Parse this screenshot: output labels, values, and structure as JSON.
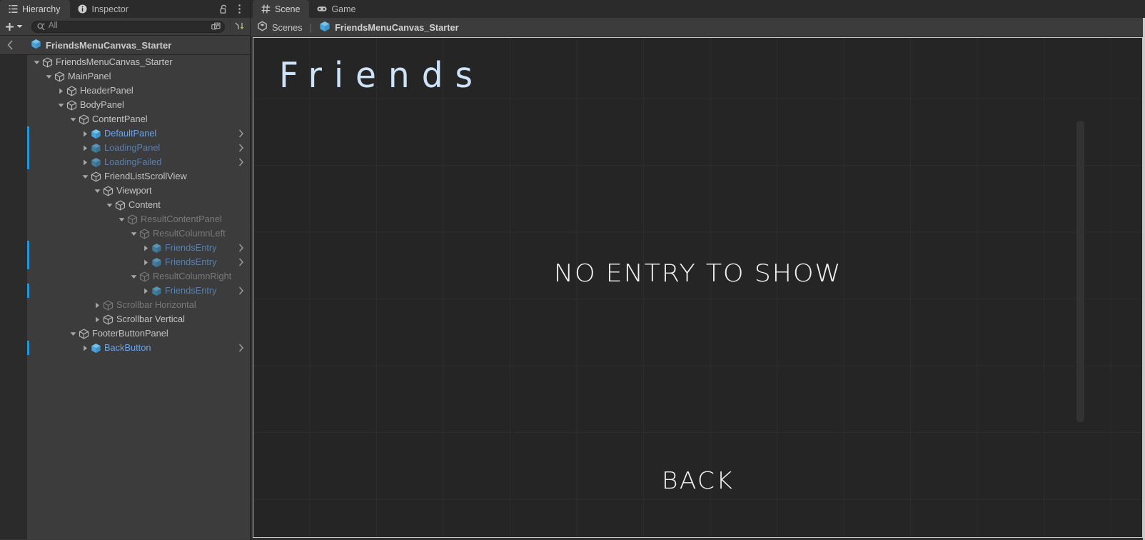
{
  "hierarchy_panel": {
    "tabs": [
      {
        "label": "Hierarchy",
        "icon": "hierarchy-icon",
        "active": true
      },
      {
        "label": "Inspector",
        "icon": "info-icon",
        "active": false
      }
    ],
    "tab_tools": [
      {
        "name": "lock-icon",
        "tooltip": "Lock"
      },
      {
        "name": "kebab-menu-icon",
        "tooltip": "More"
      }
    ],
    "toolbar": {
      "create_label": "+",
      "create_dropdown_icon": "chevron-down-icon",
      "search": {
        "value": "All",
        "placeholder": "All",
        "icon": "search-icon"
      },
      "search_in_scene_icon": "search-in-scene-icon",
      "sort_icon": "sort-icon"
    },
    "prefab_header": {
      "back_icon": "chevron-left-icon",
      "title": "FriendsMenuCanvas_Starter",
      "icon": "prefab-cube-icon"
    },
    "tree": [
      {
        "label": "FriendsMenuCanvas_Starter",
        "depth": 1,
        "twisty": "down",
        "icon": "gameobject-icon",
        "dim": false,
        "prefab": false,
        "prefab_bar": false,
        "chevron": false
      },
      {
        "label": "MainPanel",
        "depth": 2,
        "twisty": "down",
        "icon": "gameobject-icon",
        "dim": false,
        "prefab": false,
        "prefab_bar": false,
        "chevron": false
      },
      {
        "label": "HeaderPanel",
        "depth": 3,
        "twisty": "right",
        "icon": "gameobject-icon",
        "dim": false,
        "prefab": false,
        "prefab_bar": false,
        "chevron": false
      },
      {
        "label": "BodyPanel",
        "depth": 3,
        "twisty": "down",
        "icon": "gameobject-icon",
        "dim": false,
        "prefab": false,
        "prefab_bar": false,
        "chevron": false
      },
      {
        "label": "ContentPanel",
        "depth": 4,
        "twisty": "down",
        "icon": "gameobject-icon",
        "dim": false,
        "prefab": false,
        "prefab_bar": false,
        "chevron": false
      },
      {
        "label": "DefaultPanel",
        "depth": 5,
        "twisty": "right",
        "icon": "prefab-cube-icon",
        "dim": false,
        "prefab": true,
        "prefab_bar": true,
        "chevron": true
      },
      {
        "label": "LoadingPanel",
        "depth": 5,
        "twisty": "right",
        "icon": "prefab-cube-icon",
        "dim": true,
        "prefab": true,
        "prefab_bar": true,
        "chevron": true
      },
      {
        "label": "LoadingFailed",
        "depth": 5,
        "twisty": "right",
        "icon": "prefab-cube-icon",
        "dim": true,
        "prefab": true,
        "prefab_bar": true,
        "chevron": true
      },
      {
        "label": "FriendListScrollView",
        "depth": 5,
        "twisty": "down",
        "icon": "gameobject-icon",
        "dim": false,
        "prefab": false,
        "prefab_bar": false,
        "chevron": false
      },
      {
        "label": "Viewport",
        "depth": 6,
        "twisty": "down",
        "icon": "gameobject-icon",
        "dim": false,
        "prefab": false,
        "prefab_bar": false,
        "chevron": false
      },
      {
        "label": "Content",
        "depth": 7,
        "twisty": "down",
        "icon": "gameobject-icon",
        "dim": false,
        "prefab": false,
        "prefab_bar": false,
        "chevron": false
      },
      {
        "label": "ResultContentPanel",
        "depth": 8,
        "twisty": "down",
        "icon": "gameobject-icon",
        "dim": true,
        "prefab": false,
        "prefab_bar": false,
        "chevron": false
      },
      {
        "label": "ResultColumnLeft",
        "depth": 9,
        "twisty": "down",
        "icon": "gameobject-icon",
        "dim": true,
        "prefab": false,
        "prefab_bar": false,
        "chevron": false
      },
      {
        "label": "FriendsEntry",
        "depth": 10,
        "twisty": "right",
        "icon": "prefab-cube-icon",
        "dim": true,
        "prefab": true,
        "prefab_bar": true,
        "chevron": true
      },
      {
        "label": "FriendsEntry",
        "depth": 10,
        "twisty": "right",
        "icon": "prefab-cube-icon",
        "dim": true,
        "prefab": true,
        "prefab_bar": true,
        "chevron": true
      },
      {
        "label": "ResultColumnRight",
        "depth": 9,
        "twisty": "down",
        "icon": "gameobject-icon",
        "dim": true,
        "prefab": false,
        "prefab_bar": false,
        "chevron": false
      },
      {
        "label": "FriendsEntry",
        "depth": 10,
        "twisty": "right",
        "icon": "prefab-cube-icon",
        "dim": true,
        "prefab": true,
        "prefab_bar": true,
        "chevron": true
      },
      {
        "label": "Scrollbar Horizontal",
        "depth": 6,
        "twisty": "right",
        "icon": "gameobject-icon",
        "dim": true,
        "prefab": false,
        "prefab_bar": false,
        "chevron": false
      },
      {
        "label": "Scrollbar Vertical",
        "depth": 6,
        "twisty": "right",
        "icon": "gameobject-icon",
        "dim": false,
        "prefab": false,
        "prefab_bar": false,
        "chevron": false
      },
      {
        "label": "FooterButtonPanel",
        "depth": 4,
        "twisty": "down",
        "icon": "gameobject-icon",
        "dim": false,
        "prefab": false,
        "prefab_bar": false,
        "chevron": false
      },
      {
        "label": "BackButton",
        "depth": 5,
        "twisty": "right",
        "icon": "prefab-cube-icon",
        "dim": false,
        "prefab": true,
        "prefab_bar": true,
        "chevron": true
      }
    ]
  },
  "scene_panel": {
    "tabs": [
      {
        "label": "Scene",
        "icon": "grid-icon",
        "active": true
      },
      {
        "label": "Game",
        "icon": "gamepad-icon",
        "active": false
      }
    ],
    "breadcrumb": {
      "root": "Scenes",
      "separator": "|",
      "current": "FriendsMenuCanvas_Starter",
      "root_icon": "unity-logo-icon",
      "current_icon": "prefab-cube-icon"
    },
    "canvas": {
      "title": "Friends",
      "empty_message": "NO ENTRY TO SHOW",
      "back_button": "BACK",
      "scrollbar": "scene-vertical-scrollbar"
    }
  },
  "colors": {
    "prefab_blue": "#6ba4e8",
    "prefab_bar": "#2196d9",
    "title_blue": "#cde3f7",
    "panel_bg": "#3c3c3c",
    "tabstrip_bg": "#2b2b2b",
    "canvas_bg": "#252525",
    "text": "#c4c4c4",
    "text_dim": "#7a7a7a"
  }
}
